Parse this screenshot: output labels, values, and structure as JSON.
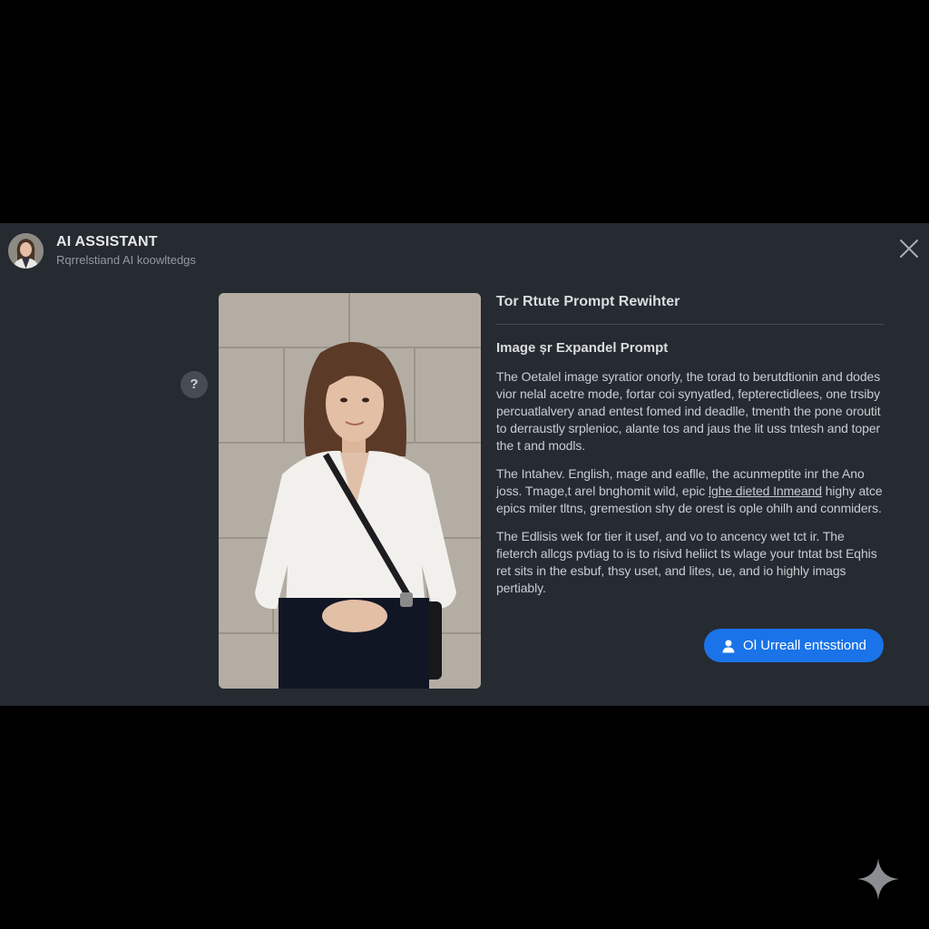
{
  "header": {
    "title": "AI ASSISTANT",
    "subtitle": "Rqrrelstiand AI koowltedgs"
  },
  "content": {
    "main_title": "Tor Rtute Prompt Rewihter",
    "section_title": "Image șr Expandel Prompt",
    "paragraphs": [
      {
        "text": "The Oetalel image syratior onorly, the torad to berutdtionin and dodes vior nelal acetre mode, fortar coi synyatled, fepterectidlees, one trsiby percuatlalvery anad entest fomed ind deadlle, tmenth the pone oroutit to derraustly srplenioc, alante tos and jaus the lit uss tntesh and toper the t and modls."
      },
      {
        "before": "The Intahev. English, mage and eaflle, the acunmeptite inr the Ano joss. Tmage,t arel bnghomit wild, epic ",
        "link": "lghe dieted Inmeand",
        "after": " highy atce epics miter tltns, gremestion shy de orest is ople ohilh and conmiders."
      },
      {
        "text": "The Edlisis wek for tier it usef, and vo to ancency wet tct ir. The fieterch allcgs pvtiag to is to risivd heliict ts wlage your tntat bst Eqhis ret sits in the esbuf, thsy uset, and lites, ue, and io highly imags pertiably."
      }
    ],
    "cta_label": "Ol Urreall entsstiond",
    "help_label": "?"
  },
  "icons": {
    "close": "close-icon",
    "help": "question-icon",
    "cta": "person-icon",
    "sparkle": "sparkle-icon",
    "avatar": "avatar-photo",
    "photo": "woman-portrait-photo"
  },
  "colors": {
    "background": "#000000",
    "panel": "#262a31",
    "accent": "#1a73e8",
    "text": "#c9cdd2"
  }
}
